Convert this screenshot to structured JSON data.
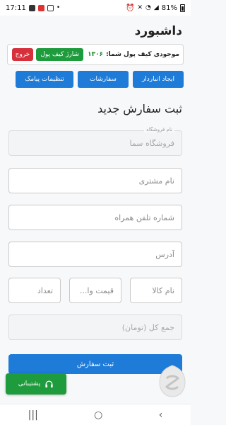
{
  "status_bar": {
    "time": "17:11",
    "battery": "81%"
  },
  "header": {
    "title": "داشبورد"
  },
  "wallet": {
    "label": "موجودی کیف پول شما:",
    "amount": "۱۳۰۶",
    "charge_label": "شارژ کیف پول",
    "logout_label": "خروج"
  },
  "nav": {
    "warehouse_label": "ایجاد انباردار",
    "orders_label": "سفارشات",
    "sms_settings_label": "تنظیمات پیامک"
  },
  "form": {
    "title": "ثبت سفارش جدید",
    "store_legend": "نام فروشگاه",
    "store_value": "فروشگاه سما",
    "customer_placeholder": "نام مشتری",
    "phone_placeholder": "شماره تلفن همراه",
    "address_placeholder": "آدرس",
    "product_placeholder": "نام کالا",
    "price_placeholder": "قیمت وا...",
    "quantity_placeholder": "تعداد",
    "total_placeholder": "جمع کل (تومان)",
    "submit_label": "ثبت سفارش"
  },
  "support": {
    "label": "پشتیبانی"
  },
  "colors": {
    "primary": "#1e7bd8",
    "success": "#1e9b3c",
    "danger": "#d6303a"
  }
}
